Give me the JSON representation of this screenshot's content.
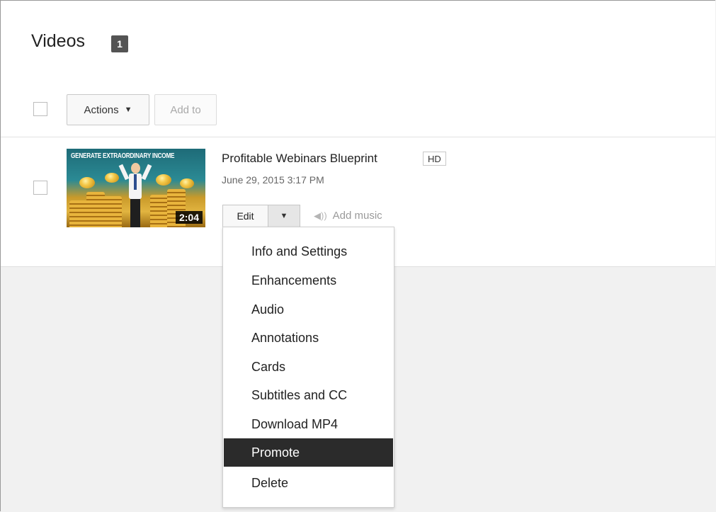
{
  "page": {
    "title": "Videos",
    "count": "1"
  },
  "toolbar": {
    "actions_label": "Actions",
    "add_to_label": "Add to"
  },
  "video": {
    "thumbnail_caption": "GENERATE EXTRAORDINARY INCOME",
    "duration": "2:04",
    "title": "Profitable Webinars Blueprint",
    "quality_badge": "HD",
    "date": "June 29, 2015 3:17 PM",
    "edit_label": "Edit",
    "add_music_label": "Add music"
  },
  "edit_menu": {
    "items": [
      {
        "label": "Info and Settings"
      },
      {
        "label": "Enhancements"
      },
      {
        "label": "Audio"
      },
      {
        "label": "Annotations"
      },
      {
        "label": "Cards"
      },
      {
        "label": "Subtitles and CC"
      },
      {
        "label": "Download MP4"
      },
      {
        "label": "Promote"
      },
      {
        "label": "Delete"
      }
    ],
    "highlighted": "Promote"
  },
  "colors": {
    "menu_highlight": "#2b2b2b",
    "badge_bg": "#545454",
    "page_bg": "#f1f1f1"
  }
}
